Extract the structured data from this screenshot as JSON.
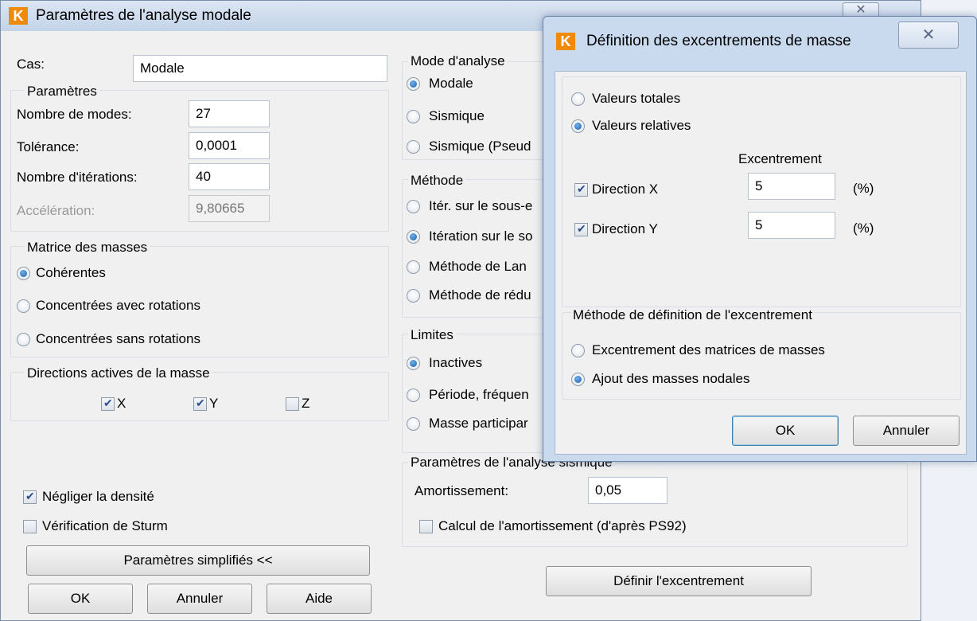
{
  "main": {
    "title": "Paramètres de l'analyse modale",
    "close_glyph": "✕",
    "cas_label": "Cas:",
    "cas_value": "Modale",
    "parametres": {
      "title": "Paramètres",
      "nb_modes_label": "Nombre de modes:",
      "nb_modes_value": "27",
      "tolerance_label": "Tolérance:",
      "tolerance_value": "0,0001",
      "iterations_label": "Nombre d'itérations:",
      "iterations_value": "40",
      "acceleration_label": "Accélération:",
      "acceleration_value": "9,80665"
    },
    "matrice": {
      "title": "Matrice des masses",
      "options": [
        "Cohérentes",
        "Concentrées avec rotations",
        "Concentrées sans rotations"
      ],
      "selected": 0
    },
    "directions": {
      "title": "Directions actives de la masse",
      "x": "X",
      "y": "Y",
      "z": "Z",
      "x_checked": true,
      "y_checked": true,
      "z_checked": false
    },
    "negliger_label": "Négliger la densité",
    "negliger_checked": true,
    "sturm_label": "Vérification de Sturm",
    "sturm_checked": false,
    "simplified_button": "Paramètres simplifiés <<",
    "ok_button": "OK",
    "cancel_button": "Annuler",
    "help_button": "Aide",
    "mode": {
      "title": "Mode d'analyse",
      "options": [
        "Modale",
        "Sismique",
        "Sismique (Pseud"
      ],
      "selected": 0
    },
    "methode": {
      "title": "Méthode",
      "options": [
        "Itér. sur le sous-e",
        "Itération sur le so",
        "Méthode de Lan",
        "Méthode de rédu"
      ],
      "selected": 1
    },
    "limites": {
      "title": "Limites",
      "options": [
        "Inactives",
        "Période, fréquen",
        "Masse participar"
      ],
      "selected": 0
    },
    "sismique": {
      "title": "Paramètres de l'analyse sismique",
      "amortissement_label": "Amortissement:",
      "amortissement_value": "0,05",
      "calcul_label": "Calcul de l'amortissement (d'après PS92)",
      "calcul_checked": false
    },
    "define_excentrement_button": "Définir l'excentrement"
  },
  "dialog": {
    "title": "Définition des excentrements de masse",
    "close_glyph": "✕",
    "valeurs_options": [
      "Valeurs totales",
      "Valeurs relatives"
    ],
    "valeurs_selected": 1,
    "excentrement_header": "Excentrement",
    "direction_x_label": "Direction X",
    "direction_x_checked": true,
    "direction_x_value": "5",
    "direction_y_label": "Direction Y",
    "direction_y_checked": true,
    "direction_y_value": "5",
    "unit": "(%)",
    "methode_title": "Méthode de définition de l'excentrement",
    "methode_options": [
      "Excentrement des matrices de masses",
      "Ajout des masses nodales"
    ],
    "methode_selected": 1,
    "ok_button": "OK",
    "cancel_button": "Annuler"
  }
}
